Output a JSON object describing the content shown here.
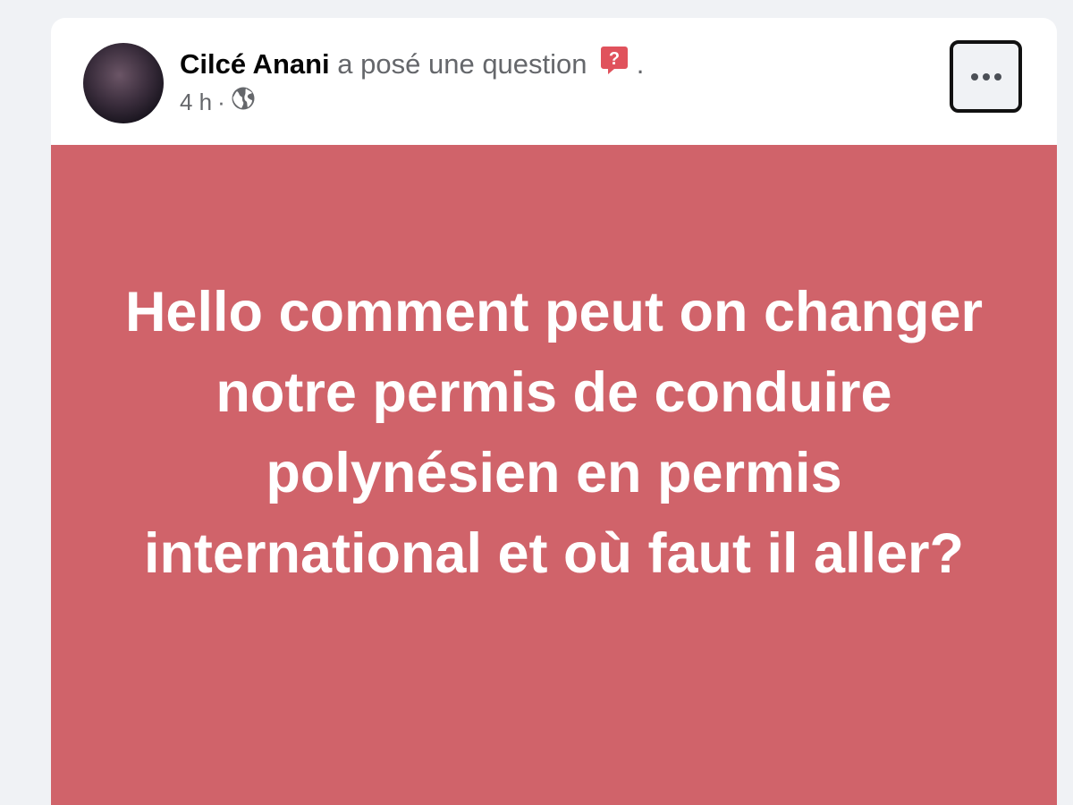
{
  "post": {
    "author": "Cilcé Anani",
    "action": "a posé une question",
    "trailing": ".",
    "time": "4 h",
    "separator": "·",
    "audience_icon": "globe-icon",
    "question_icon": "question-badge-icon",
    "more_icon": "more-horizontal-icon",
    "body": "Hello comment peut on changer notre permis de conduire polynésien en permis international et où faut il aller?",
    "background_color": "#d0636a"
  }
}
